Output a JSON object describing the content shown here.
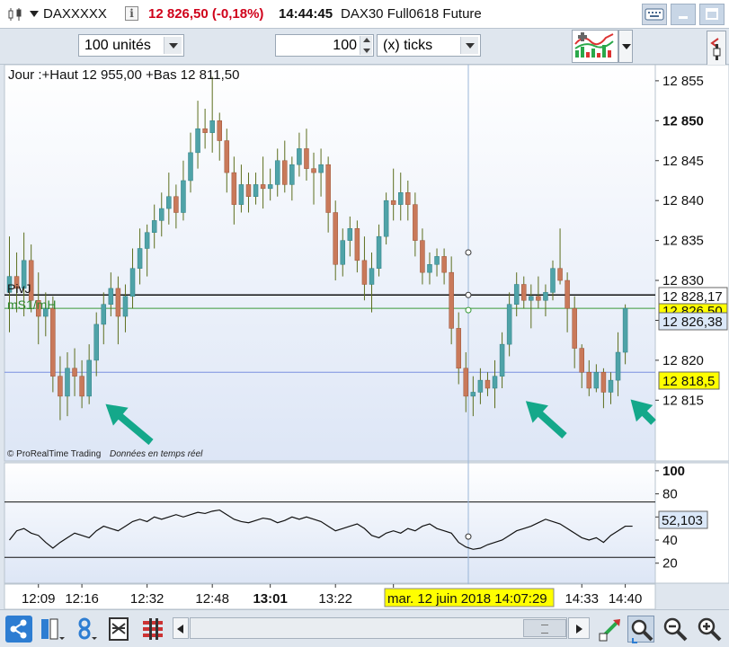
{
  "window": {
    "instrument": "DAXXXXX",
    "price_change": "12 826,50 (-0,18%)",
    "time": "14:44:45",
    "contract": "DAX30 Full0618 Future"
  },
  "toolbar": {
    "units_select": "100 unités",
    "ticks_value": "100",
    "ticks_unit_select": "(x) ticks"
  },
  "chart": {
    "header": "Jour :+Haut 12 955,00 +Bas 12 811,50",
    "footer_brand": "© ProRealTime Trading",
    "footer_realtime": "Données en temps réel",
    "piv_label": "PivJ",
    "ms_label": "mS1/mH",
    "cursor_time_label": "mar. 12 juin 2018 14:07:29",
    "tags": {
      "piv": "12 828,17",
      "ms": "12 826,50",
      "last": "12 826,38",
      "cursor": "12 818,5",
      "osc": "52,103"
    },
    "colors": {
      "up": "#4fa3a8",
      "down": "#c9795a",
      "wick": "#5c6e1e",
      "arrow": "#14a88a",
      "last_tag": "#ffff00"
    }
  },
  "chart_data": [
    {
      "type": "candlestick",
      "ylim": [
        12812,
        12856
      ],
      "yticks": [
        {
          "label": "12 855",
          "value": 12855,
          "bold": false
        },
        {
          "label": "12 850",
          "value": 12850,
          "bold": true
        },
        {
          "label": "12 845",
          "value": 12845,
          "bold": false
        },
        {
          "label": "12 840",
          "value": 12840,
          "bold": false
        },
        {
          "label": "12 835",
          "value": 12835,
          "bold": false
        },
        {
          "label": "12 830",
          "value": 12830,
          "bold": false
        },
        {
          "label": "12 825",
          "value": 12825,
          "bold": false
        },
        {
          "label": "12 820",
          "value": 12820,
          "bold": false
        },
        {
          "label": "12 815",
          "value": 12815,
          "bold": false
        }
      ],
      "xticks": [
        {
          "label": "12:09",
          "index": 4,
          "bold": false
        },
        {
          "label": "12:16",
          "index": 10,
          "bold": false
        },
        {
          "label": "12:32",
          "index": 19,
          "bold": false
        },
        {
          "label": "12:48",
          "index": 28,
          "bold": false
        },
        {
          "label": "13:01",
          "index": 36,
          "bold": true
        },
        {
          "label": "13:22",
          "index": 45,
          "bold": false
        },
        {
          "label": "13",
          "index": 53,
          "bold": false
        },
        {
          "label": "14:33",
          "index": 79,
          "bold": false
        },
        {
          "label": "14:40",
          "index": 85,
          "bold": false
        }
      ],
      "hlines": {
        "pivot": 12828.17,
        "ms": 12826.5,
        "cursor": 12818.5
      },
      "candles": [
        {
          "o": 12828.5,
          "h": 12835.5,
          "l": 12823.5,
          "c": 12830.5
        },
        {
          "o": 12830.5,
          "h": 12833.5,
          "l": 12826.0,
          "c": 12829.0
        },
        {
          "o": 12829.0,
          "h": 12836.0,
          "l": 12825.5,
          "c": 12832.5
        },
        {
          "o": 12832.5,
          "h": 12834.5,
          "l": 12826.0,
          "c": 12827.5
        },
        {
          "o": 12827.5,
          "h": 12831.0,
          "l": 12822.0,
          "c": 12825.5
        },
        {
          "o": 12825.5,
          "h": 12828.5,
          "l": 12823.0,
          "c": 12826.5
        },
        {
          "o": 12826.5,
          "h": 12828.0,
          "l": 12816.0,
          "c": 12818.0
        },
        {
          "o": 12818.0,
          "h": 12820.5,
          "l": 12812.5,
          "c": 12815.5
        },
        {
          "o": 12815.5,
          "h": 12821.0,
          "l": 12813.0,
          "c": 12819.0
        },
        {
          "o": 12819.0,
          "h": 12821.5,
          "l": 12815.5,
          "c": 12818.0
        },
        {
          "o": 12818.0,
          "h": 12820.0,
          "l": 12814.0,
          "c": 12815.5
        },
        {
          "o": 12815.5,
          "h": 12822.0,
          "l": 12814.5,
          "c": 12820.0
        },
        {
          "o": 12820.0,
          "h": 12826.0,
          "l": 12818.0,
          "c": 12824.5
        },
        {
          "o": 12824.5,
          "h": 12828.5,
          "l": 12822.0,
          "c": 12827.0
        },
        {
          "o": 12827.0,
          "h": 12831.0,
          "l": 12825.5,
          "c": 12829.0
        },
        {
          "o": 12829.0,
          "h": 12830.5,
          "l": 12822.0,
          "c": 12825.5
        },
        {
          "o": 12825.5,
          "h": 12829.5,
          "l": 12823.5,
          "c": 12828.0
        },
        {
          "o": 12828.0,
          "h": 12834.0,
          "l": 12826.5,
          "c": 12831.5
        },
        {
          "o": 12831.5,
          "h": 12836.5,
          "l": 12829.5,
          "c": 12834.0
        },
        {
          "o": 12834.0,
          "h": 12837.0,
          "l": 12830.5,
          "c": 12836.0
        },
        {
          "o": 12836.0,
          "h": 12839.5,
          "l": 12834.0,
          "c": 12837.5
        },
        {
          "o": 12837.5,
          "h": 12841.0,
          "l": 12835.5,
          "c": 12839.0
        },
        {
          "o": 12839.0,
          "h": 12843.5,
          "l": 12837.0,
          "c": 12840.5
        },
        {
          "o": 12840.5,
          "h": 12842.0,
          "l": 12836.5,
          "c": 12838.5
        },
        {
          "o": 12838.5,
          "h": 12845.0,
          "l": 12837.5,
          "c": 12842.5
        },
        {
          "o": 12842.5,
          "h": 12848.5,
          "l": 12841.0,
          "c": 12846.0
        },
        {
          "o": 12846.0,
          "h": 12852.5,
          "l": 12844.0,
          "c": 12849.0
        },
        {
          "o": 12849.0,
          "h": 12851.5,
          "l": 12846.5,
          "c": 12848.5
        },
        {
          "o": 12848.5,
          "h": 12855.5,
          "l": 12846.0,
          "c": 12850.0
        },
        {
          "o": 12850.0,
          "h": 12851.0,
          "l": 12845.0,
          "c": 12847.5
        },
        {
          "o": 12847.5,
          "h": 12849.0,
          "l": 12841.0,
          "c": 12843.5
        },
        {
          "o": 12843.5,
          "h": 12845.5,
          "l": 12837.0,
          "c": 12839.5
        },
        {
          "o": 12839.5,
          "h": 12844.5,
          "l": 12838.5,
          "c": 12842.0
        },
        {
          "o": 12842.0,
          "h": 12843.5,
          "l": 12838.5,
          "c": 12840.5
        },
        {
          "o": 12840.5,
          "h": 12843.5,
          "l": 12839.5,
          "c": 12842.0
        },
        {
          "o": 12842.0,
          "h": 12845.5,
          "l": 12839.0,
          "c": 12841.5
        },
        {
          "o": 12841.5,
          "h": 12844.0,
          "l": 12840.0,
          "c": 12842.0
        },
        {
          "o": 12842.0,
          "h": 12846.5,
          "l": 12840.5,
          "c": 12845.0
        },
        {
          "o": 12845.0,
          "h": 12847.5,
          "l": 12841.0,
          "c": 12842.0
        },
        {
          "o": 12842.0,
          "h": 12845.5,
          "l": 12840.0,
          "c": 12844.5
        },
        {
          "o": 12844.5,
          "h": 12848.5,
          "l": 12843.0,
          "c": 12846.5
        },
        {
          "o": 12846.5,
          "h": 12849.0,
          "l": 12842.5,
          "c": 12844.0
        },
        {
          "o": 12844.0,
          "h": 12846.0,
          "l": 12839.5,
          "c": 12843.5
        },
        {
          "o": 12843.5,
          "h": 12846.5,
          "l": 12840.5,
          "c": 12844.5
        },
        {
          "o": 12844.5,
          "h": 12845.5,
          "l": 12836.0,
          "c": 12838.5
        },
        {
          "o": 12838.5,
          "h": 12840.0,
          "l": 12830.0,
          "c": 12832.0
        },
        {
          "o": 12832.0,
          "h": 12836.5,
          "l": 12830.5,
          "c": 12835.0
        },
        {
          "o": 12835.0,
          "h": 12838.0,
          "l": 12833.0,
          "c": 12836.5
        },
        {
          "o": 12836.5,
          "h": 12837.5,
          "l": 12831.0,
          "c": 12832.5
        },
        {
          "o": 12832.5,
          "h": 12835.5,
          "l": 12827.5,
          "c": 12829.5
        },
        {
          "o": 12829.5,
          "h": 12833.5,
          "l": 12826.0,
          "c": 12831.5
        },
        {
          "o": 12831.5,
          "h": 12837.0,
          "l": 12830.5,
          "c": 12835.5
        },
        {
          "o": 12835.5,
          "h": 12841.0,
          "l": 12834.5,
          "c": 12840.0
        },
        {
          "o": 12840.0,
          "h": 12844.0,
          "l": 12837.5,
          "c": 12839.5
        },
        {
          "o": 12839.5,
          "h": 12843.5,
          "l": 12837.5,
          "c": 12841.0
        },
        {
          "o": 12841.0,
          "h": 12842.5,
          "l": 12837.5,
          "c": 12839.5
        },
        {
          "o": 12839.5,
          "h": 12841.0,
          "l": 12833.0,
          "c": 12835.0
        },
        {
          "o": 12835.0,
          "h": 12836.5,
          "l": 12829.5,
          "c": 12831.0
        },
        {
          "o": 12831.0,
          "h": 12833.5,
          "l": 12829.5,
          "c": 12832.0
        },
        {
          "o": 12832.0,
          "h": 12834.0,
          "l": 12830.5,
          "c": 12833.0
        },
        {
          "o": 12833.0,
          "h": 12834.0,
          "l": 12829.5,
          "c": 12831.0
        },
        {
          "o": 12831.0,
          "h": 12833.0,
          "l": 12822.0,
          "c": 12824.0
        },
        {
          "o": 12824.0,
          "h": 12826.0,
          "l": 12817.0,
          "c": 12819.0
        },
        {
          "o": 12819.0,
          "h": 12821.0,
          "l": 12813.5,
          "c": 12815.5
        },
        {
          "o": 12815.5,
          "h": 12818.0,
          "l": 12813.0,
          "c": 12816.0
        },
        {
          "o": 12816.0,
          "h": 12819.0,
          "l": 12814.5,
          "c": 12817.5
        },
        {
          "o": 12817.5,
          "h": 12818.5,
          "l": 12815.5,
          "c": 12816.5
        },
        {
          "o": 12816.5,
          "h": 12820.0,
          "l": 12814.0,
          "c": 12818.0
        },
        {
          "o": 12818.0,
          "h": 12823.5,
          "l": 12816.5,
          "c": 12822.0
        },
        {
          "o": 12822.0,
          "h": 12828.5,
          "l": 12820.5,
          "c": 12827.0
        },
        {
          "o": 12827.0,
          "h": 12831.0,
          "l": 12825.5,
          "c": 12829.5
        },
        {
          "o": 12829.5,
          "h": 12830.5,
          "l": 12826.5,
          "c": 12827.5
        },
        {
          "o": 12827.5,
          "h": 12829.5,
          "l": 12824.0,
          "c": 12828.0
        },
        {
          "o": 12828.0,
          "h": 12830.5,
          "l": 12826.5,
          "c": 12827.5
        },
        {
          "o": 12827.5,
          "h": 12829.5,
          "l": 12825.5,
          "c": 12828.5
        },
        {
          "o": 12828.5,
          "h": 12832.5,
          "l": 12827.5,
          "c": 12831.5
        },
        {
          "o": 12831.5,
          "h": 12836.5,
          "l": 12829.5,
          "c": 12830.0
        },
        {
          "o": 12830.0,
          "h": 12831.0,
          "l": 12823.5,
          "c": 12826.5
        },
        {
          "o": 12826.5,
          "h": 12828.0,
          "l": 12819.0,
          "c": 12821.5
        },
        {
          "o": 12821.5,
          "h": 12822.0,
          "l": 12816.5,
          "c": 12818.5
        },
        {
          "o": 12818.5,
          "h": 12820.0,
          "l": 12815.5,
          "c": 12816.5
        },
        {
          "o": 12816.5,
          "h": 12819.5,
          "l": 12816.0,
          "c": 12818.5
        },
        {
          "o": 12818.5,
          "h": 12819.0,
          "l": 12814.0,
          "c": 12816.0
        },
        {
          "o": 12816.0,
          "h": 12818.5,
          "l": 12814.5,
          "c": 12817.5
        },
        {
          "o": 12817.5,
          "h": 12823.5,
          "l": 12815.5,
          "c": 12821.0
        },
        {
          "o": 12821.0,
          "h": 12827.0,
          "l": 12819.5,
          "c": 12826.5
        }
      ]
    },
    {
      "type": "line",
      "ylim": [
        5,
        103
      ],
      "yticks": [
        {
          "label": "100",
          "value": 100,
          "bold": true
        },
        {
          "label": "80",
          "value": 80,
          "bold": false
        },
        {
          "label": "60",
          "value": 60,
          "bold": false
        },
        {
          "label": "40",
          "value": 40,
          "bold": false
        },
        {
          "label": "20",
          "value": 20,
          "bold": false
        }
      ],
      "levels": [
        73,
        25
      ],
      "values": [
        40,
        48,
        50,
        46,
        44,
        38,
        33,
        38,
        42,
        46,
        44,
        42,
        48,
        52,
        50,
        48,
        52,
        56,
        58,
        56,
        60,
        58,
        60,
        62,
        60,
        62,
        64,
        63,
        65,
        66,
        62,
        58,
        56,
        55,
        57,
        59,
        58,
        55,
        57,
        60,
        58,
        60,
        58,
        56,
        52,
        48,
        50,
        52,
        54,
        50,
        44,
        42,
        46,
        48,
        46,
        50,
        48,
        52,
        54,
        50,
        48,
        46,
        38,
        34,
        32,
        33,
        36,
        38,
        40,
        44,
        48,
        50,
        52,
        55,
        58,
        56,
        54,
        50,
        46,
        42,
        40,
        42,
        38,
        44,
        48,
        52,
        52
      ]
    }
  ]
}
